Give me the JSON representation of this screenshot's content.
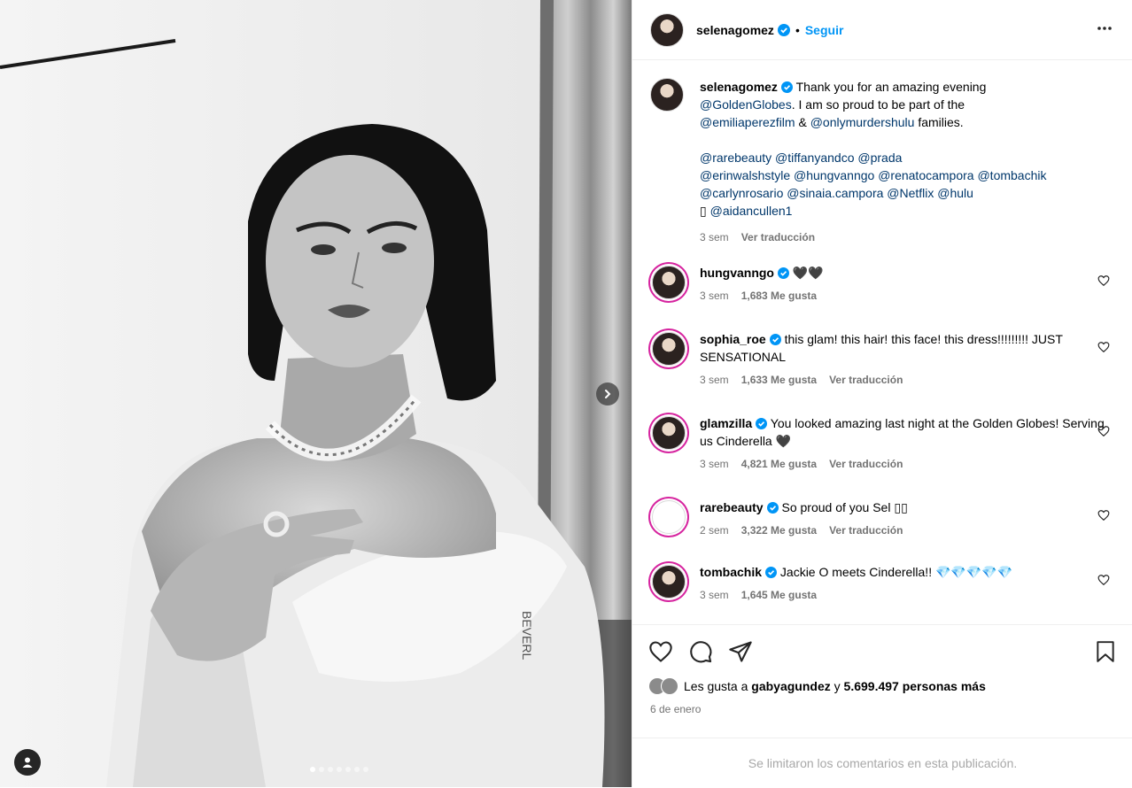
{
  "post_author": {
    "username": "selenagomez",
    "separator": "•",
    "follow_label": "Seguir"
  },
  "caption": {
    "username": "selenagomez",
    "text_1": "Thank you for an amazing evening",
    "mention_1": "@GoldenGlobes",
    "text_2": ". I am so proud to be part of the",
    "mention_2": "@emiliaperezfilm",
    "text_3": "&",
    "mention_3": "@onlymurdershulu",
    "text_4": "families.",
    "tags_line_1": "@rarebeauty @tiffanyandco @prada",
    "tags_line_2": "@erinwalshstyle @hungvanngo @renatocampora @tombachik",
    "tags_line_3": "@carlynrosario @sinaia.campora @Netflix @hulu",
    "tags_line_4_prefix": "",
    "tags_line_4": "@aidancullen1",
    "time": "3 sem",
    "translate": "Ver traducción"
  },
  "comments": [
    {
      "username": "hungvanngo",
      "text": "🖤🖤",
      "time": "3 sem",
      "likes": "1,683 Me gusta",
      "translate": ""
    },
    {
      "username": "sophia_roe",
      "text": "this glam! this hair! this face! this dress!!!!!!!!! JUST SENSATIONAL",
      "time": "3 sem",
      "likes": "1,633 Me gusta",
      "translate": "Ver traducción"
    },
    {
      "username": "glamzilla",
      "text": "You looked amazing last night at the Golden Globes! Serving us Cinderella 🖤",
      "time": "3 sem",
      "likes": "4,821 Me gusta",
      "translate": "Ver traducción"
    },
    {
      "username": "rarebeauty",
      "text": "So proud of you Sel ",
      "time": "2 sem",
      "likes": "3,322 Me gusta",
      "translate": "Ver traducción"
    },
    {
      "username": "tombachik",
      "text": "Jackie O meets Cinderella!! 💎💎💎💎💎",
      "time": "3 sem",
      "likes": "1,645 Me gusta",
      "translate": ""
    }
  ],
  "likes_line": {
    "prefix": "Les gusta a",
    "user": "gabyagundez",
    "middle": "y",
    "count": "5.699.497 personas más"
  },
  "date": "6 de enero",
  "comments_limited": "Se limitaron los comentarios en esta publicación.",
  "colors": {
    "accent_blue": "#0095f6",
    "link_blue": "#00376b",
    "muted": "#737373",
    "verified": "#0095f6"
  },
  "icons": [
    "chevron-right-icon",
    "user-tag-icon",
    "more-icon",
    "heart-icon",
    "comment-icon",
    "share-icon",
    "save-icon",
    "verified-badge-icon"
  ]
}
